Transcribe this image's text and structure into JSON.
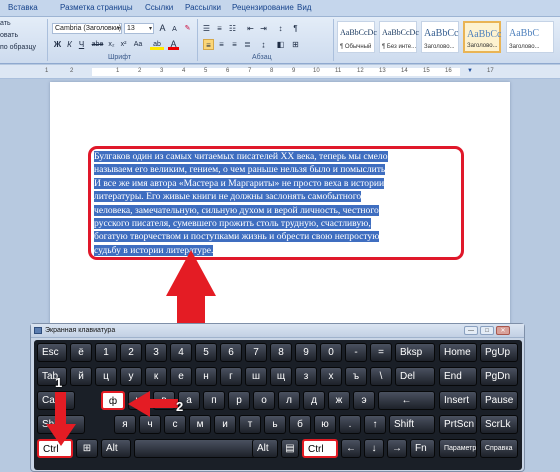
{
  "ribbon": {
    "tabs": [
      "Вставка",
      "Разметка страницы",
      "Ссылки",
      "Рассылки",
      "Рецензирование",
      "Вид"
    ],
    "clipboard_items": [
      "ать",
      "овать",
      "по образцу"
    ],
    "font_name": "Cambria (Заголовки)",
    "font_size": "13",
    "group_font": "Шрифт",
    "group_paragraph": "Абзац",
    "styles": [
      {
        "sample": "AaBbCcDc",
        "name": "¶ Обычный"
      },
      {
        "sample": "AaBbCcDc",
        "name": "¶ Без инте..."
      },
      {
        "sample": "AaBbCc",
        "name": "Заголово..."
      },
      {
        "sample": "AaBbCc",
        "name": "Заголово..."
      },
      {
        "sample": "AaBbC",
        "name": "Заголово..."
      }
    ],
    "buttons": {
      "grow_font": "A",
      "shrink_font": "A",
      "bold": "Ж",
      "italic": "К",
      "underline": "Ч",
      "strike": "abe",
      "subscript": "x₂",
      "superscript": "x²",
      "change_case": "Aa",
      "highlight": "ab",
      "font_color": "A"
    },
    "accent_color": "#15428b"
  },
  "ruler": {
    "numbers": [
      "1",
      "2",
      "1",
      "2",
      "3",
      "4",
      "5",
      "6",
      "7",
      "8",
      "9",
      "10",
      "11",
      "12",
      "13",
      "14",
      "15",
      "16",
      "17"
    ]
  },
  "document": {
    "selected_text_lines": [
      "Булгаков один из самых читаемых писателей XX века, теперь мы смело",
      "называем его великим, гением, о чем раньше нельзя было и помыслить",
      "И все же имя автора «Мастера и Маргариты» не просто веха в истории",
      "литературы. Его живые книги не должны заслонять самобытного",
      "человека, замечательную, сильную духом и верой личность, честного",
      "русского писателя, сумевшего прожить столь трудную, счастливую,",
      "богатую творчеством и поступками жизнь и обрести свою непростую",
      "судьбу в истории литературе."
    ],
    "selection_color": "#3f6ec0",
    "highlight_border_color": "#e0182a"
  },
  "keyboard": {
    "title": "Экранная клавиатура",
    "window_controls": [
      "—",
      "□",
      "✕"
    ],
    "row1": [
      "Esc",
      "ё",
      "1",
      "2",
      "3",
      "4",
      "5",
      "6",
      "7",
      "8",
      "9",
      "0",
      "-",
      "=",
      "Bksp",
      "Home",
      "PgUp"
    ],
    "row2": [
      "Tab",
      "й",
      "ц",
      "у",
      "к",
      "е",
      "н",
      "г",
      "ш",
      "щ",
      "з",
      "х",
      "ъ",
      "\\",
      "Del",
      "End",
      "PgDn"
    ],
    "row3": [
      "Caps",
      "ф",
      "ы",
      "в",
      "а",
      "п",
      "р",
      "о",
      "л",
      "д",
      "ж",
      "э",
      "←",
      "Insert",
      "Pause"
    ],
    "row4": [
      "Shift",
      "я",
      "ч",
      "с",
      "м",
      "и",
      "т",
      "ь",
      "б",
      "ю",
      ".",
      "↑",
      "Shift",
      "PrtScn",
      "ScrLk"
    ],
    "row5": [
      "Ctrl",
      "⊞",
      "Alt",
      "",
      "Alt",
      "▤",
      "Ctrl",
      "←",
      "↓",
      "→",
      "Fn",
      "Параметры",
      "Справка"
    ],
    "step_badges": [
      "1",
      "2"
    ],
    "arrow_color": "#e41c24"
  }
}
